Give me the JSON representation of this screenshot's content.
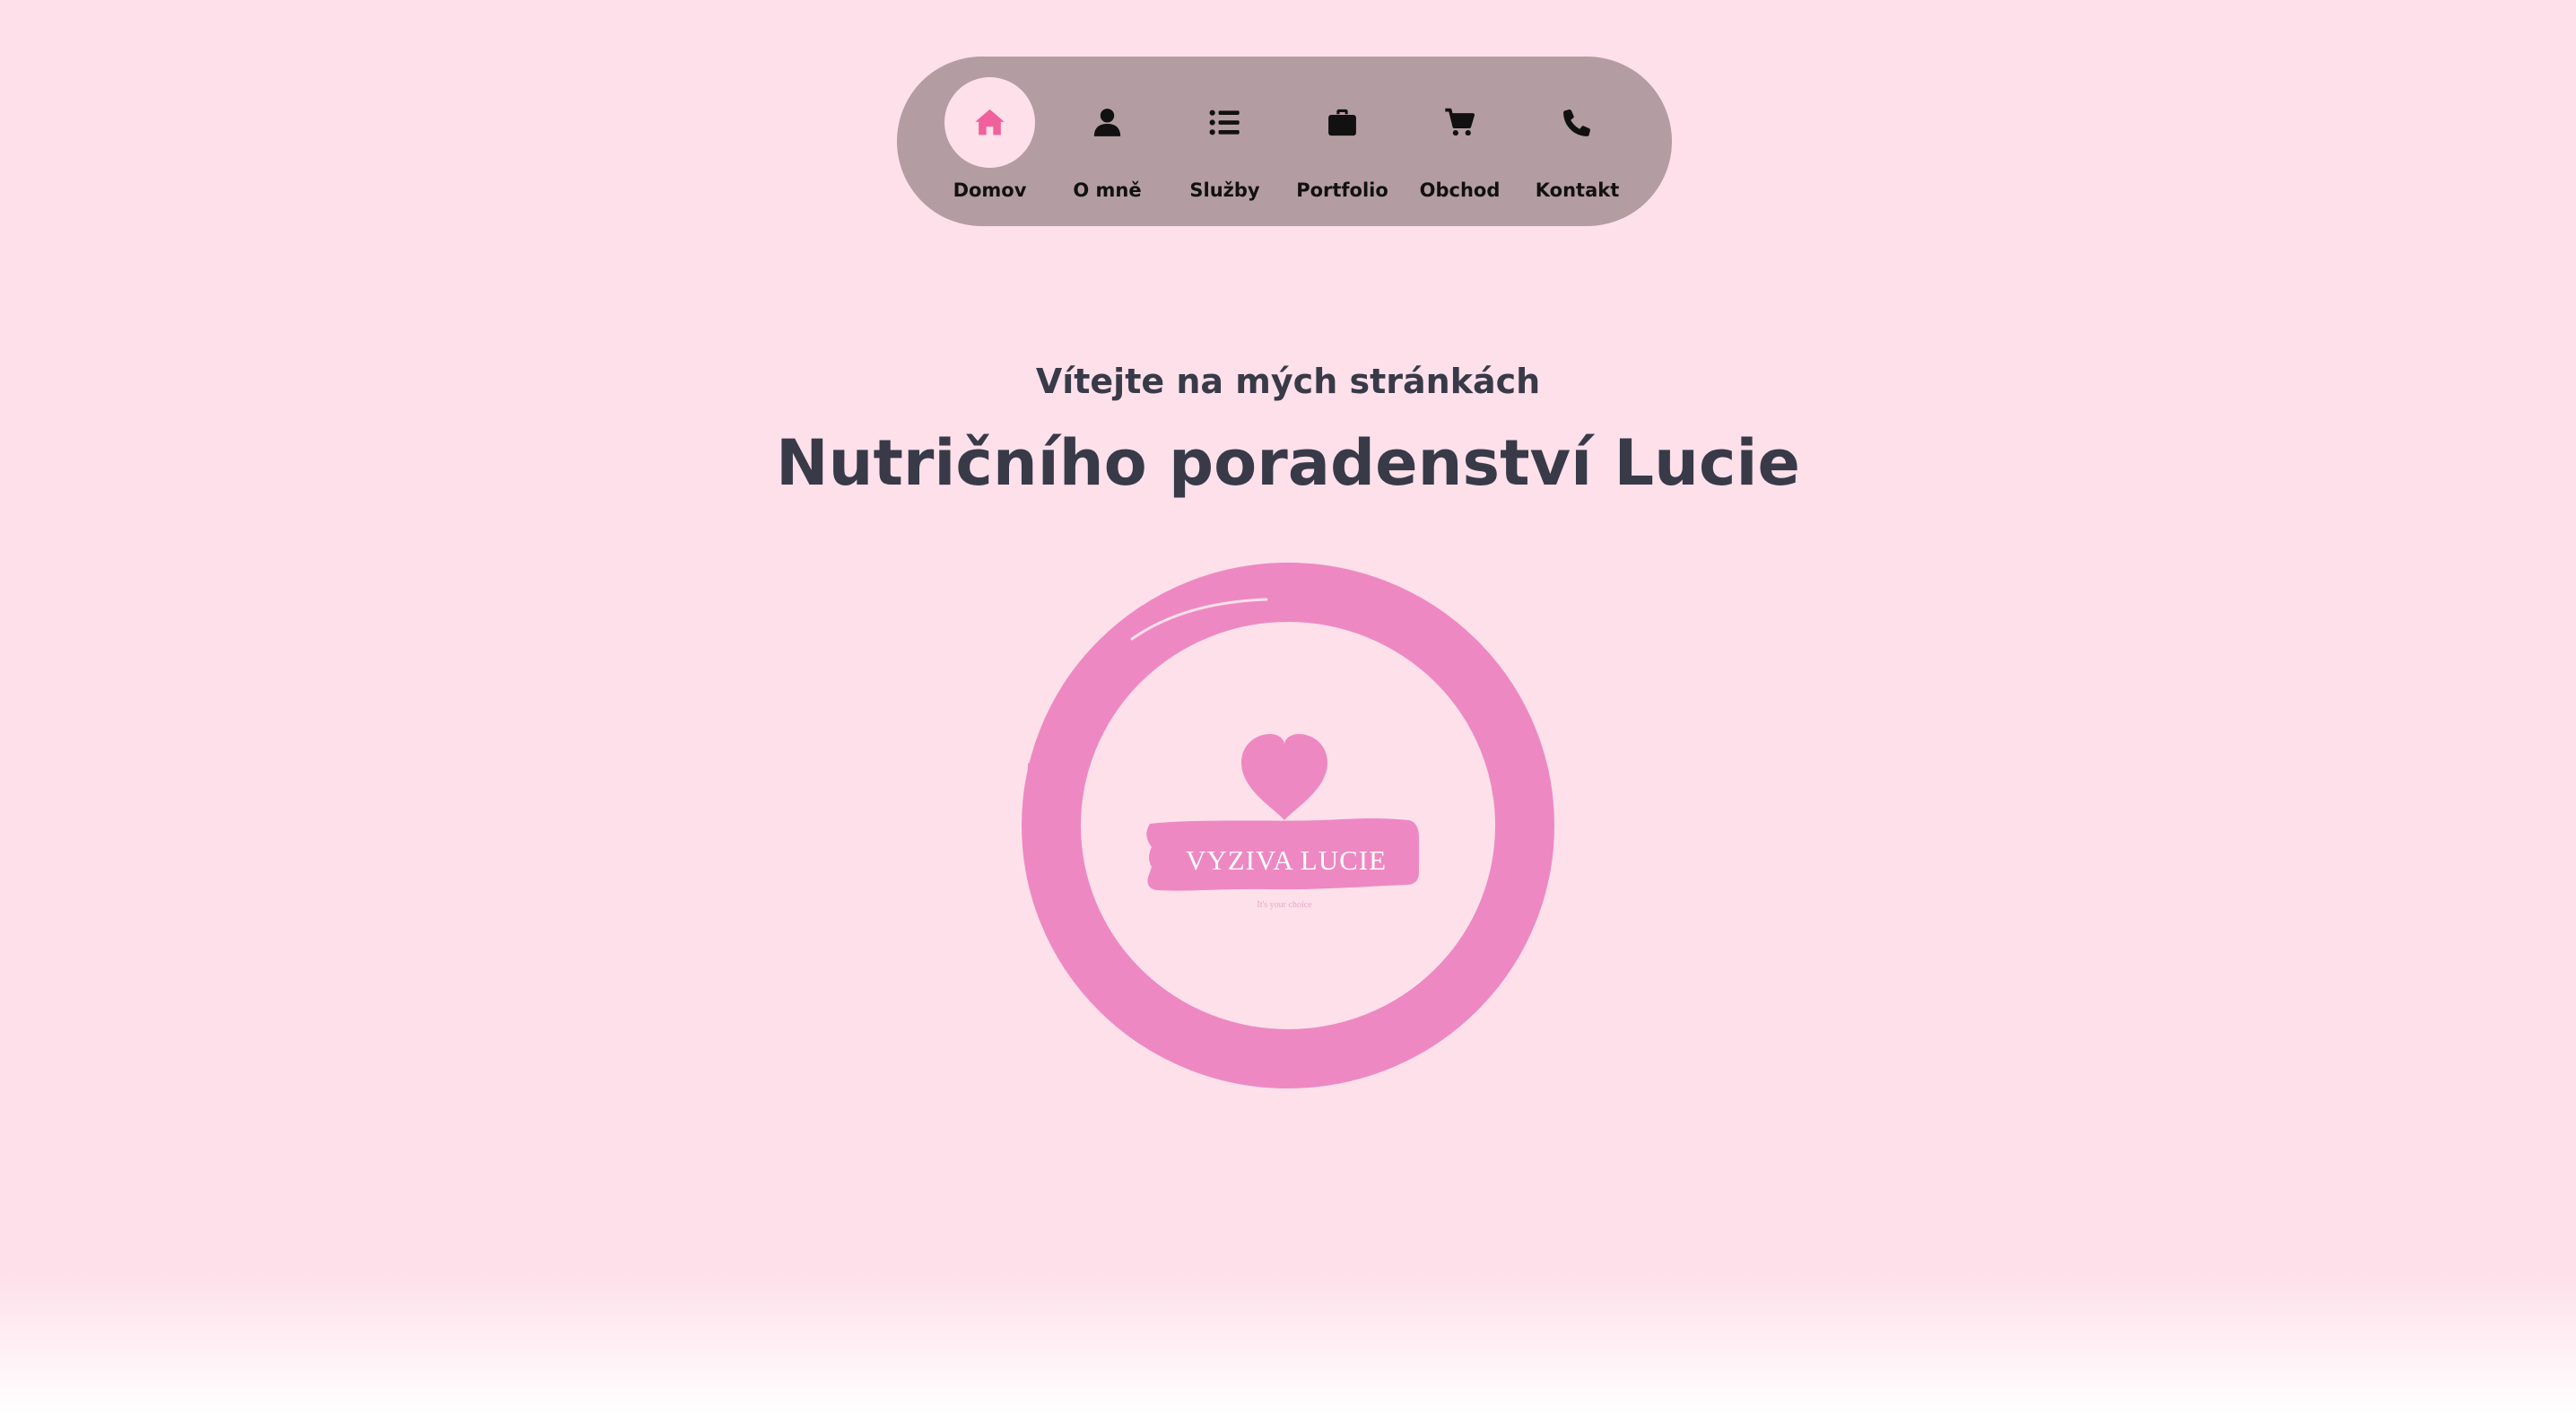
{
  "nav": {
    "items": [
      {
        "label": "Domov",
        "icon": "home-icon",
        "active": true
      },
      {
        "label": "O mně",
        "icon": "user-icon",
        "active": false
      },
      {
        "label": "Služby",
        "icon": "list-icon",
        "active": false
      },
      {
        "label": "Portfolio",
        "icon": "briefcase-icon",
        "active": false
      },
      {
        "label": "Obchod",
        "icon": "cart-icon",
        "active": false
      },
      {
        "label": "Kontakt",
        "icon": "phone-icon",
        "active": false
      }
    ]
  },
  "hero": {
    "welcome": "Vítejte na mých stránkách",
    "title": "Nutričního poradenství Lucie"
  },
  "logo": {
    "brand": "VYZIVA LUCIE",
    "tagline": "It's your choice"
  },
  "colors": {
    "background": "#fde0ea",
    "nav_bg": "#b49ca3",
    "accent": "#f0609a",
    "logo_pink": "#ee88c2",
    "text_dark": "#383a48"
  }
}
